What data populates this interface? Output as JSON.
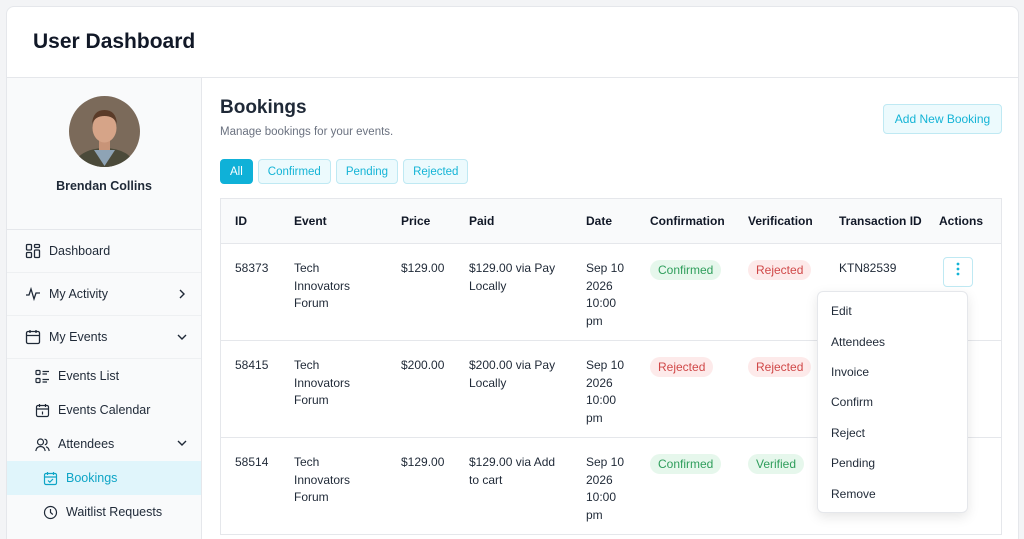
{
  "app": {
    "title": "User Dashboard"
  },
  "profile": {
    "name": "Brendan Collins"
  },
  "sidebar": {
    "items": [
      {
        "label": "Dashboard",
        "icon": "dashboard-icon"
      },
      {
        "label": "My Activity",
        "icon": "activity-icon"
      },
      {
        "label": "My Events",
        "icon": "calendar-icon"
      }
    ],
    "sub": [
      {
        "label": "Events List",
        "icon": "list-icon"
      },
      {
        "label": "Events Calendar",
        "icon": "calendar-icon"
      },
      {
        "label": "Attendees",
        "icon": "users-icon"
      }
    ],
    "subsub": [
      {
        "label": "Bookings",
        "icon": "calendar-check-icon"
      },
      {
        "label": "Waitlist Requests",
        "icon": "clock-icon"
      }
    ]
  },
  "page": {
    "title": "Bookings",
    "subtitle": "Manage bookings for your events.",
    "add_button": "Add New Booking"
  },
  "filters": [
    "All",
    "Confirmed",
    "Pending",
    "Rejected"
  ],
  "table": {
    "headers": [
      "ID",
      "Event",
      "Price",
      "Paid",
      "Date",
      "Confirmation",
      "Verification",
      "Transaction ID",
      "Actions"
    ],
    "rows": [
      {
        "id": "58373",
        "event": "Tech Innovators Forum",
        "price": "$129.00",
        "paid": "$129.00 via Pay Locally",
        "date": "Sep 10 2026 10:00 pm",
        "confirmation": "Confirmed",
        "verification": "Rejected",
        "transaction": "KTN82539"
      },
      {
        "id": "58415",
        "event": "Tech Innovators Forum",
        "price": "$200.00",
        "paid": "$200.00 via Pay Locally",
        "date": "Sep 10 2026 10:00 pm",
        "confirmation": "Rejected",
        "verification": "Rejected",
        "transaction": ""
      },
      {
        "id": "58514",
        "event": "Tech Innovators Forum",
        "price": "$129.00",
        "paid": "$129.00 via Add to cart",
        "date": "Sep 10 2026 10:00 pm",
        "confirmation": "Confirmed",
        "verification": "Verified",
        "transaction": ""
      }
    ]
  },
  "menu": {
    "items": [
      "Edit",
      "Attendees",
      "Invoice",
      "Confirm",
      "Reject",
      "Pending",
      "Remove"
    ]
  },
  "colors": {
    "accent": "#0fb1d8",
    "success": "#2f9e5c",
    "danger": "#d04848"
  }
}
